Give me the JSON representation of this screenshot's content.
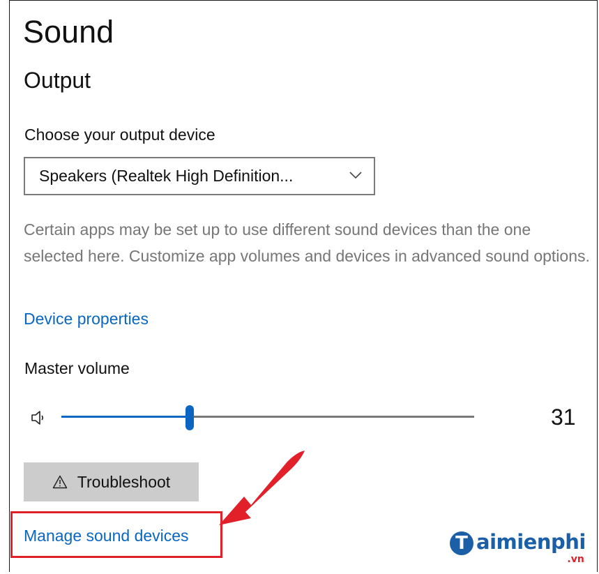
{
  "page": {
    "title": "Sound"
  },
  "output": {
    "section_title": "Output",
    "device_label": "Choose your output device",
    "selected_device": "Speakers (Realtek High Definition...",
    "description": "Certain apps may be set up to use different sound devices than the one selected here. Customize app volumes and devices in advanced sound options.",
    "device_properties_link": "Device properties",
    "master_volume_label": "Master volume",
    "master_volume_value": "31",
    "master_volume_level": 31,
    "troubleshoot_label": "Troubleshoot",
    "manage_devices_link": "Manage sound devices"
  },
  "icons": {
    "chevron": "chevron-down-icon",
    "speaker": "speaker-icon",
    "warning": "warning-icon"
  },
  "watermark": {
    "logo_letter": "T",
    "text": "aimienphi",
    "suffix": ".vn"
  },
  "colors": {
    "accent": "#0a66c2",
    "muted_text": "#767676",
    "button_bg": "#cccccc",
    "annotation": "#e1202a"
  }
}
